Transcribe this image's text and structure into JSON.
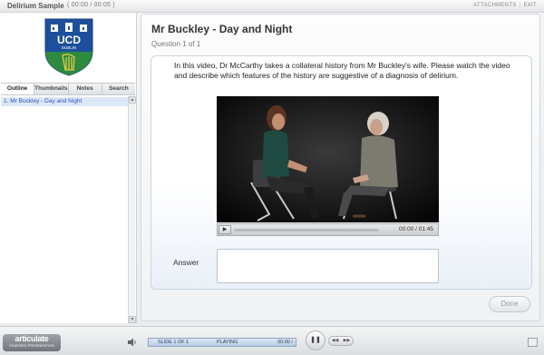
{
  "app": {
    "title": "Delirium Sample",
    "time": "( 00:00 / 00:05 )",
    "attachments_label": "ATTACHMENTS",
    "exit_label": "EXIT"
  },
  "logo": {
    "text": "UCD",
    "subtext": "DUBLIN"
  },
  "sidebar": {
    "tabs": [
      {
        "label": "Outline",
        "active": true
      },
      {
        "label": "Thumbnails",
        "active": false
      },
      {
        "label": "Notes",
        "active": false
      },
      {
        "label": "Search",
        "active": false
      }
    ],
    "outline_items": [
      "1. Mr Buckley - Day and Night"
    ]
  },
  "slide": {
    "title": "Mr Buckley - Day and Night",
    "question_number": "Question 1 of 1",
    "prompt": "In this video, Dr McCarthy takes a collateral history from Mr Buckley's wife. Please watch the video and describe which features of the history are suggestive of a diagnosis of delirium.",
    "video_time": "00:00 / 01:45",
    "video_progress": 0,
    "answer_label": "Answer",
    "answer_value": "",
    "done_label": "Done"
  },
  "player": {
    "brand": "articulate",
    "brand_sub": "POWERED PRESENTATION",
    "slide_count": "SLIDE 1 OF 1",
    "status": "PLAYING",
    "time": "00:00 /"
  },
  "colors": {
    "accent_blue": "#2b51c2",
    "status_blue": "#b9cbe3",
    "harp_green": "#2d8a3f",
    "ucd_blue": "#1d4f9c"
  }
}
